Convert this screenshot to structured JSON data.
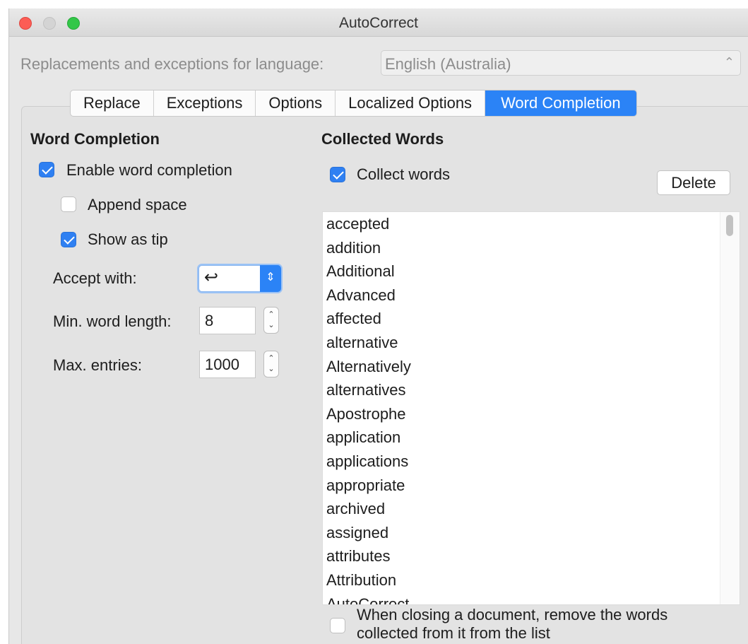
{
  "window": {
    "title": "AutoCorrect"
  },
  "language": {
    "label": "Replacements and exceptions for language:",
    "selected": "English (Australia)"
  },
  "tabs": [
    {
      "label": "Replace",
      "active": false
    },
    {
      "label": "Exceptions",
      "active": false
    },
    {
      "label": "Options",
      "active": false
    },
    {
      "label": "Localized Options",
      "active": false
    },
    {
      "label": "Word Completion",
      "active": true
    }
  ],
  "word_completion": {
    "heading": "Word Completion",
    "enable": {
      "label": "Enable word completion",
      "checked": true
    },
    "append_space": {
      "label": "Append space",
      "checked": false
    },
    "show_as_tip": {
      "label": "Show as tip",
      "checked": true
    },
    "accept_with": {
      "label": "Accept with:",
      "value": "↩"
    },
    "min_word_length": {
      "label": "Min. word length:",
      "value": "8"
    },
    "max_entries": {
      "label": "Max. entries:",
      "value": "1000"
    }
  },
  "collected_words": {
    "heading": "Collected Words",
    "collect": {
      "label": "Collect words",
      "checked": true
    },
    "delete_label": "Delete",
    "words": [
      "accepted",
      "addition",
      "Additional",
      "Advanced",
      "affected",
      "alternative",
      "Alternatively",
      "alternatives",
      "Apostrophe",
      "application",
      "applications",
      "appropriate",
      "archived",
      "assigned",
      "attributes",
      "Attribution",
      "AutoCorrect"
    ],
    "remove_on_close": {
      "label_line1": "When closing a document, remove the words",
      "label_line2": "collected from it from the list",
      "checked": false
    }
  },
  "colors": {
    "accent": "#2b83f6",
    "checkbox": "#2f80f2"
  }
}
